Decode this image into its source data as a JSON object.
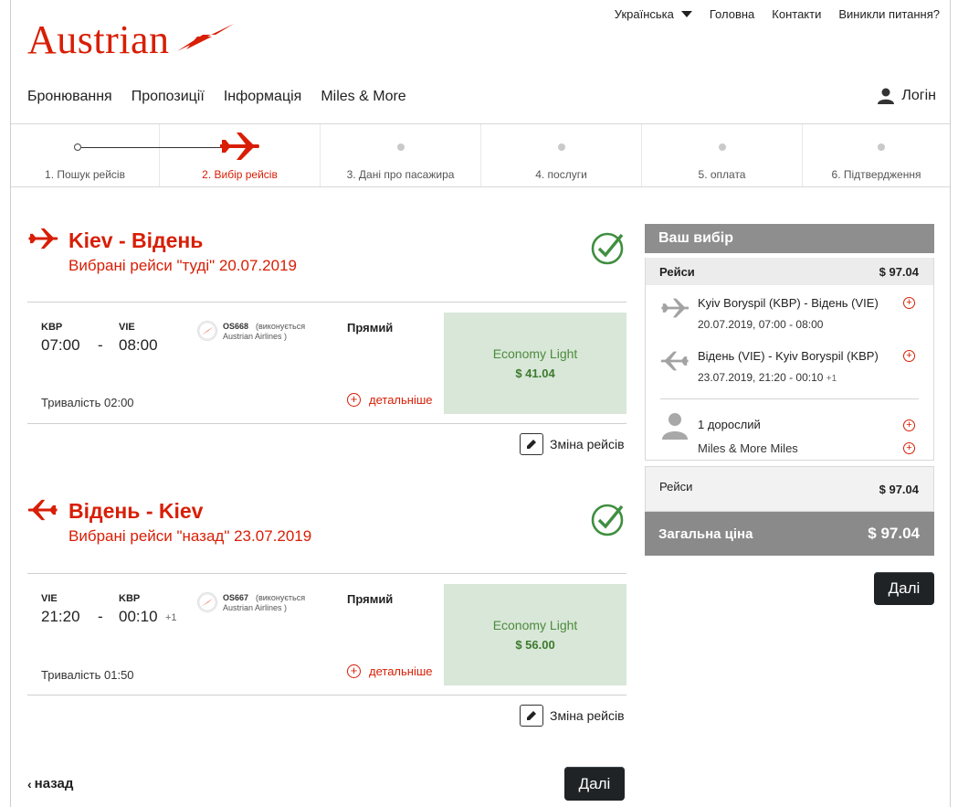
{
  "brand": {
    "logo_text": "Austrian",
    "accent_color": "#d81e05"
  },
  "top_links": {
    "language": "Українська",
    "home": "Головна",
    "contacts": "Контакти",
    "help": "Виникли питання?"
  },
  "main_nav": {
    "items": [
      "Бронювання",
      "Пропозиції",
      "Інформація",
      "Miles & More"
    ],
    "login": "Логін"
  },
  "steps": [
    {
      "label": "1. Пошук рейсів",
      "state": "done"
    },
    {
      "label": "2. Вибір рейсів",
      "state": "active"
    },
    {
      "label": "3. Дані про пасажира",
      "state": "pending"
    },
    {
      "label": "4. послуги",
      "state": "pending"
    },
    {
      "label": "5. оплата",
      "state": "pending"
    },
    {
      "label": "6. Підтвердження",
      "state": "pending"
    }
  ],
  "outbound": {
    "title": "Kiev - Відень",
    "subtitle": "Вибрані рейси \"туді\" 20.07.2019",
    "from_code": "KBP",
    "to_code": "VIE",
    "dep_time": "07:00",
    "arr_time": "08:00",
    "dash": "-",
    "flight_no": "OS668",
    "operated_text": "(виконується",
    "operator": "Austrian Airlines )",
    "type": "Прямий",
    "duration": "Тривалість 02:00",
    "details": "детальніше",
    "fare_name": "Economy Light",
    "fare_price": "$ 41.04",
    "change": "Зміна рейсів"
  },
  "inbound": {
    "title": "Відень - Kiev",
    "subtitle": "Вибрані рейси \"назад\" 23.07.2019",
    "from_code": "VIE",
    "to_code": "KBP",
    "dep_time": "21:20",
    "arr_time": "00:10",
    "day_offset": "+1",
    "dash": "-",
    "flight_no": "OS667",
    "operated_text": "(виконується",
    "operator": "Austrian Airlines )",
    "type": "Прямий",
    "duration": "Тривалість 01:50",
    "details": "детальніше",
    "fare_name": "Economy Light",
    "fare_price": "$ 56.00",
    "change": "Зміна рейсів"
  },
  "sidebar": {
    "title": "Ваш вибір",
    "flights_label": "Рейси",
    "flights_price": "$ 97.04",
    "leg1_route": "Kyiv Boryspil (KBP) - Відень (VIE)",
    "leg1_time": "20.07.2019, 07:00 - 08:00",
    "leg2_route": "Відень (VIE) - Kyiv Boryspil (KBP)",
    "leg2_time": "23.07.2019, 21:20 - 00:10",
    "leg2_offset": "+1",
    "passengers": "1 дорослий",
    "miles": "Miles & More Miles",
    "sum_label": "Рейси",
    "sum_value": "$ 97.04",
    "total_label": "Загальна ціна",
    "total_value": "$ 97.04",
    "next": "Далі"
  },
  "footer": {
    "back": "назад",
    "next": "Далі"
  }
}
